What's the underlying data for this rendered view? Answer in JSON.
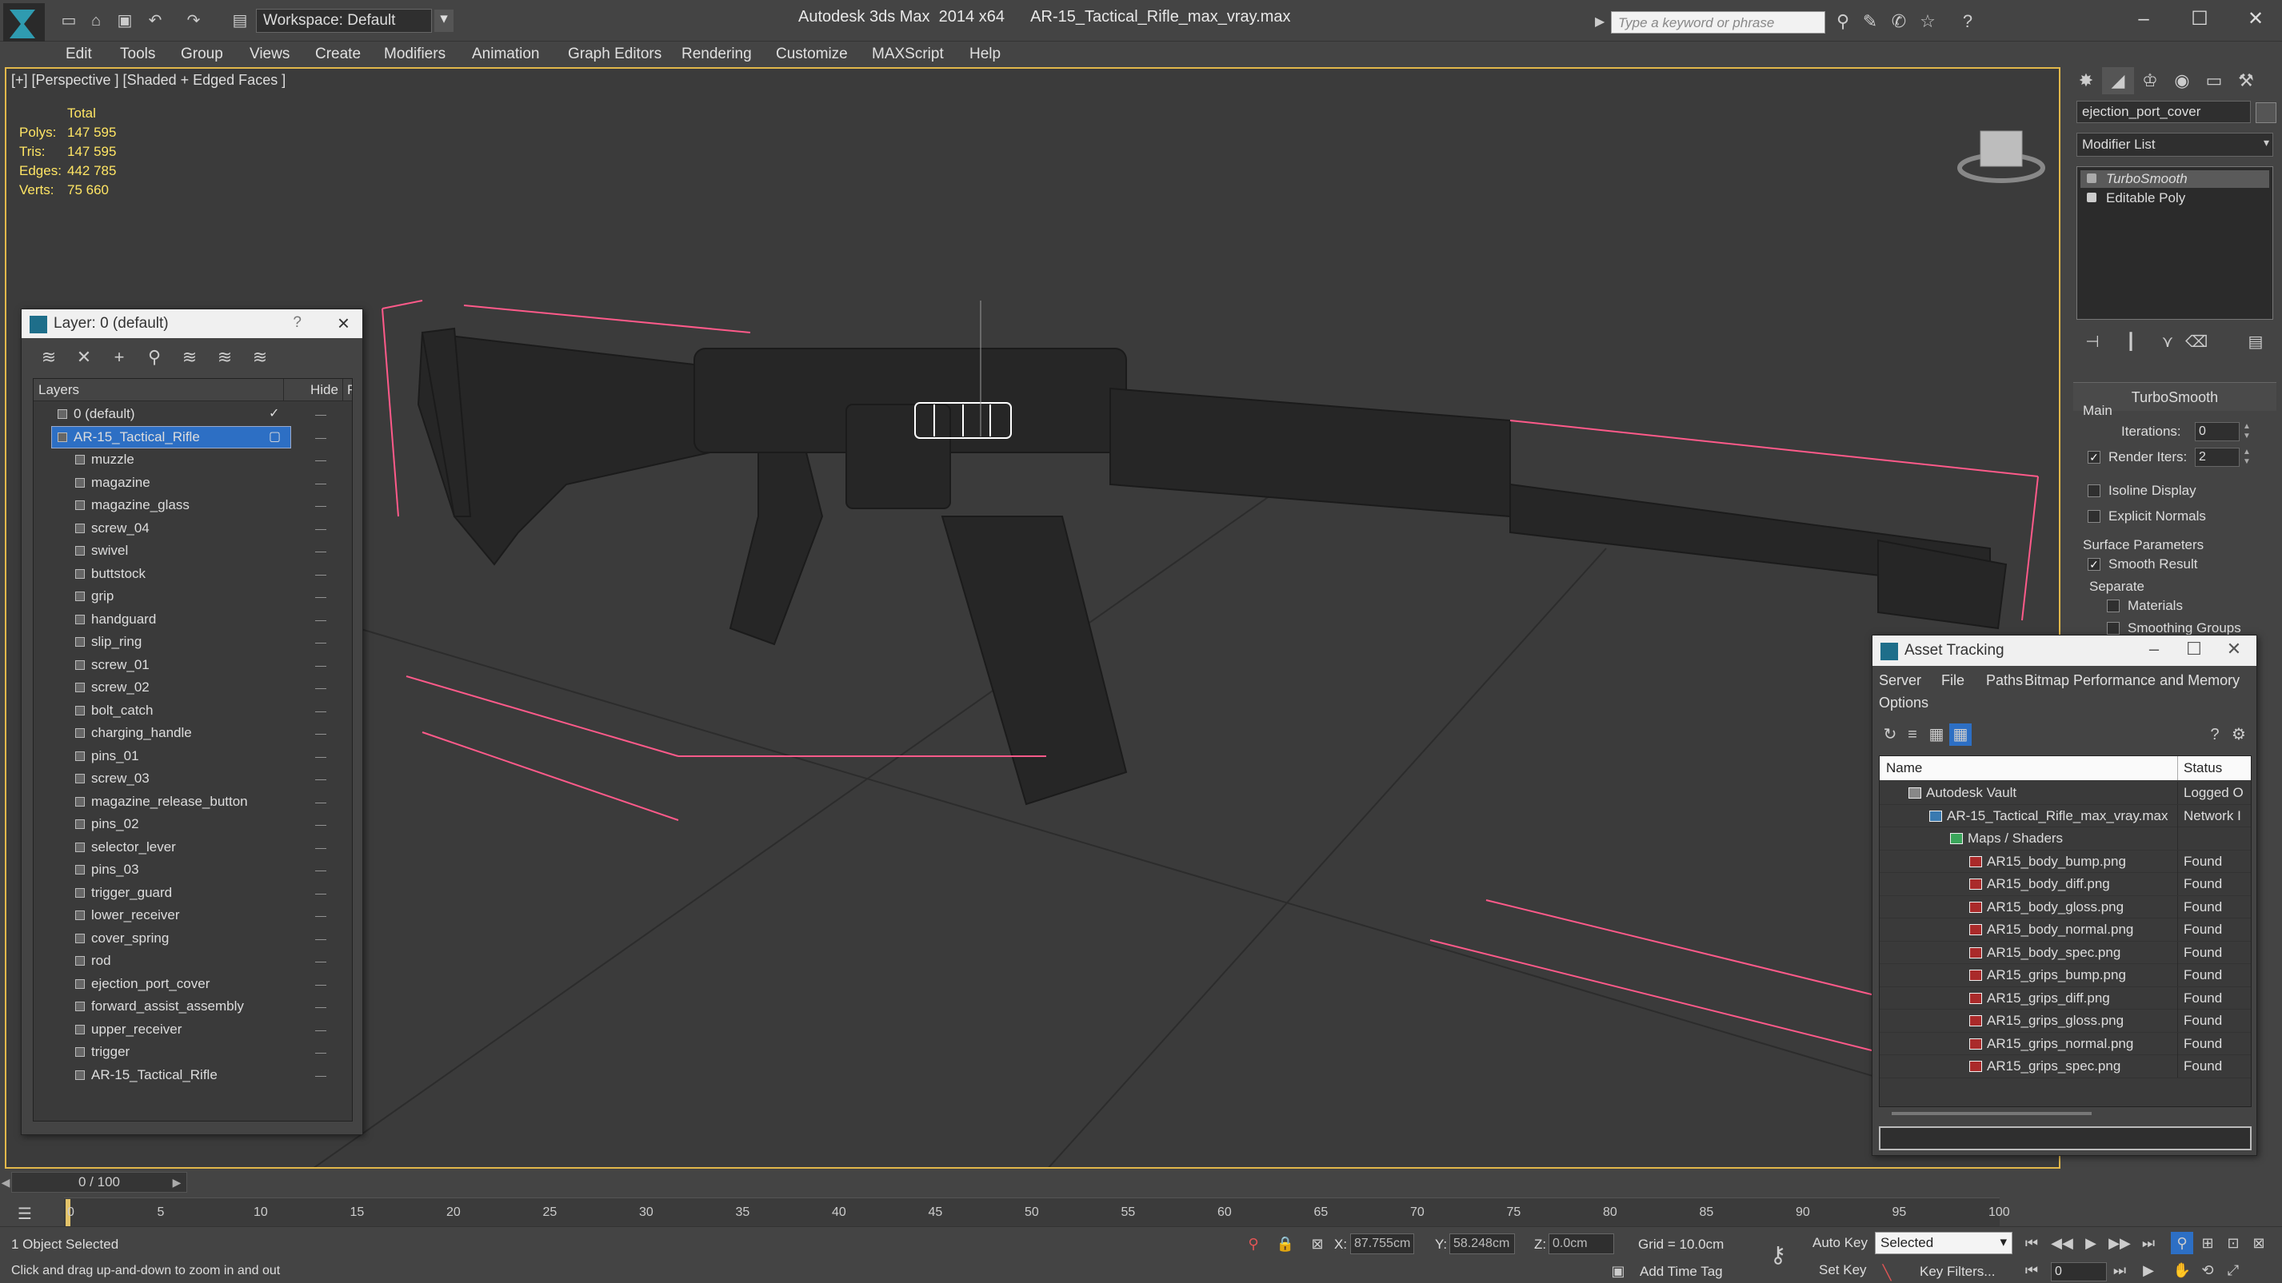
{
  "titlebar": {
    "workspace": "Workspace: Default",
    "app_title": "Autodesk 3ds Max  2014 x64      AR-15_Tactical_Rifle_max_vray.max",
    "search_placeholder": "Type a keyword or phrase"
  },
  "menu": [
    "Edit",
    "Tools",
    "Group",
    "Views",
    "Create",
    "Modifiers",
    "Animation",
    "Graph Editors",
    "Rendering",
    "Customize",
    "MAXScript",
    "Help"
  ],
  "viewport": {
    "label": "[+] [Perspective ] [Shaded + Edged Faces ]",
    "stats_header": "Total",
    "stats": [
      {
        "label": "Polys:",
        "value": "147 595"
      },
      {
        "label": "Tris:",
        "value": "147 595"
      },
      {
        "label": "Edges:",
        "value": "442 785"
      },
      {
        "label": "Verts:",
        "value": "75 660"
      }
    ],
    "selection_color": "#ff5a8a"
  },
  "command_panel": {
    "object_name": "ejection_port_cover",
    "modifier_list": "Modifier List",
    "stack": [
      "TurboSmooth",
      "Editable Poly"
    ],
    "rollout_title": "TurboSmooth",
    "main_label": "Main",
    "iterations_label": "Iterations:",
    "iterations_value": "0",
    "render_iters_label": "Render Iters:",
    "render_iters_value": "2",
    "isoline_label": "Isoline Display",
    "explicit_normals_label": "Explicit Normals",
    "surface_params_label": "Surface Parameters",
    "smooth_result_label": "Smooth Result",
    "separate_label": "Separate",
    "materials_label": "Materials",
    "smoothing_groups_label": "Smoothing Groups"
  },
  "layer_window": {
    "title": "Layer: 0 (default)",
    "help": "?",
    "col_layers": "Layers",
    "col_hide": "Hide",
    "col_f": "F",
    "hide_marker": "—",
    "rows": [
      {
        "name": "0 (default)",
        "level": 0,
        "selected": false,
        "check": true
      },
      {
        "name": "AR-15_Tactical_Rifle",
        "level": 0,
        "selected": true,
        "check": false
      },
      {
        "name": "muzzle",
        "level": 1
      },
      {
        "name": "magazine",
        "level": 1
      },
      {
        "name": "magazine_glass",
        "level": 1
      },
      {
        "name": "screw_04",
        "level": 1
      },
      {
        "name": "swivel",
        "level": 1
      },
      {
        "name": "buttstock",
        "level": 1
      },
      {
        "name": "grip",
        "level": 1
      },
      {
        "name": "handguard",
        "level": 1
      },
      {
        "name": "slip_ring",
        "level": 1
      },
      {
        "name": "screw_01",
        "level": 1
      },
      {
        "name": "screw_02",
        "level": 1
      },
      {
        "name": "bolt_catch",
        "level": 1
      },
      {
        "name": "charging_handle",
        "level": 1
      },
      {
        "name": "pins_01",
        "level": 1
      },
      {
        "name": "screw_03",
        "level": 1
      },
      {
        "name": "magazine_release_button",
        "level": 1
      },
      {
        "name": "pins_02",
        "level": 1
      },
      {
        "name": "selector_lever",
        "level": 1
      },
      {
        "name": "pins_03",
        "level": 1
      },
      {
        "name": "trigger_guard",
        "level": 1
      },
      {
        "name": "lower_receiver",
        "level": 1
      },
      {
        "name": "cover_spring",
        "level": 1
      },
      {
        "name": "rod",
        "level": 1
      },
      {
        "name": "ejection_port_cover",
        "level": 1
      },
      {
        "name": "forward_assist_assembly",
        "level": 1
      },
      {
        "name": "upper_receiver",
        "level": 1
      },
      {
        "name": "trigger",
        "level": 1
      },
      {
        "name": "AR-15_Tactical_Rifle",
        "level": 1
      }
    ]
  },
  "asset_window": {
    "title": "Asset Tracking",
    "menu": [
      "Server",
      "File",
      "Paths",
      "Bitmap Performance and Memory",
      "Options"
    ],
    "col_name": "Name",
    "col_status": "Status",
    "rows": [
      {
        "name": "Autodesk Vault",
        "status": "Logged O",
        "level": 0,
        "kind": "vault"
      },
      {
        "name": "AR-15_Tactical_Rifle_max_vray.max",
        "status": "Network I",
        "level": 1,
        "kind": "max"
      },
      {
        "name": "Maps / Shaders",
        "status": "",
        "level": 2,
        "kind": "folder"
      },
      {
        "name": "AR15_body_bump.png",
        "status": "Found",
        "level": 3,
        "kind": "png"
      },
      {
        "name": "AR15_body_diff.png",
        "status": "Found",
        "level": 3,
        "kind": "png"
      },
      {
        "name": "AR15_body_gloss.png",
        "status": "Found",
        "level": 3,
        "kind": "png"
      },
      {
        "name": "AR15_body_normal.png",
        "status": "Found",
        "level": 3,
        "kind": "png"
      },
      {
        "name": "AR15_body_spec.png",
        "status": "Found",
        "level": 3,
        "kind": "png"
      },
      {
        "name": "AR15_grips_bump.png",
        "status": "Found",
        "level": 3,
        "kind": "png"
      },
      {
        "name": "AR15_grips_diff.png",
        "status": "Found",
        "level": 3,
        "kind": "png"
      },
      {
        "name": "AR15_grips_gloss.png",
        "status": "Found",
        "level": 3,
        "kind": "png"
      },
      {
        "name": "AR15_grips_normal.png",
        "status": "Found",
        "level": 3,
        "kind": "png"
      },
      {
        "name": "AR15_grips_spec.png",
        "status": "Found",
        "level": 3,
        "kind": "png"
      }
    ]
  },
  "timeline": {
    "frame_display": "0 / 100",
    "ticks": [
      "0",
      "5",
      "10",
      "15",
      "20",
      "25",
      "30",
      "35",
      "40",
      "45",
      "50",
      "55",
      "60",
      "65",
      "70",
      "75",
      "80",
      "85",
      "90",
      "95",
      "100"
    ]
  },
  "status": {
    "selection": "1 Object Selected",
    "prompt": "Click and drag up-and-down to zoom in and out",
    "x_label": "X:",
    "x_value": "87.755cm",
    "y_label": "Y:",
    "y_value": "58.248cm",
    "z_label": "Z:",
    "z_value": "0.0cm",
    "grid": "Grid = 10.0cm",
    "add_time_tag": "Add Time Tag",
    "auto_key": "Auto Key",
    "set_key": "Set Key",
    "key_mode": "Selected",
    "key_filters": "Key Filters...",
    "current_frame": "0"
  }
}
